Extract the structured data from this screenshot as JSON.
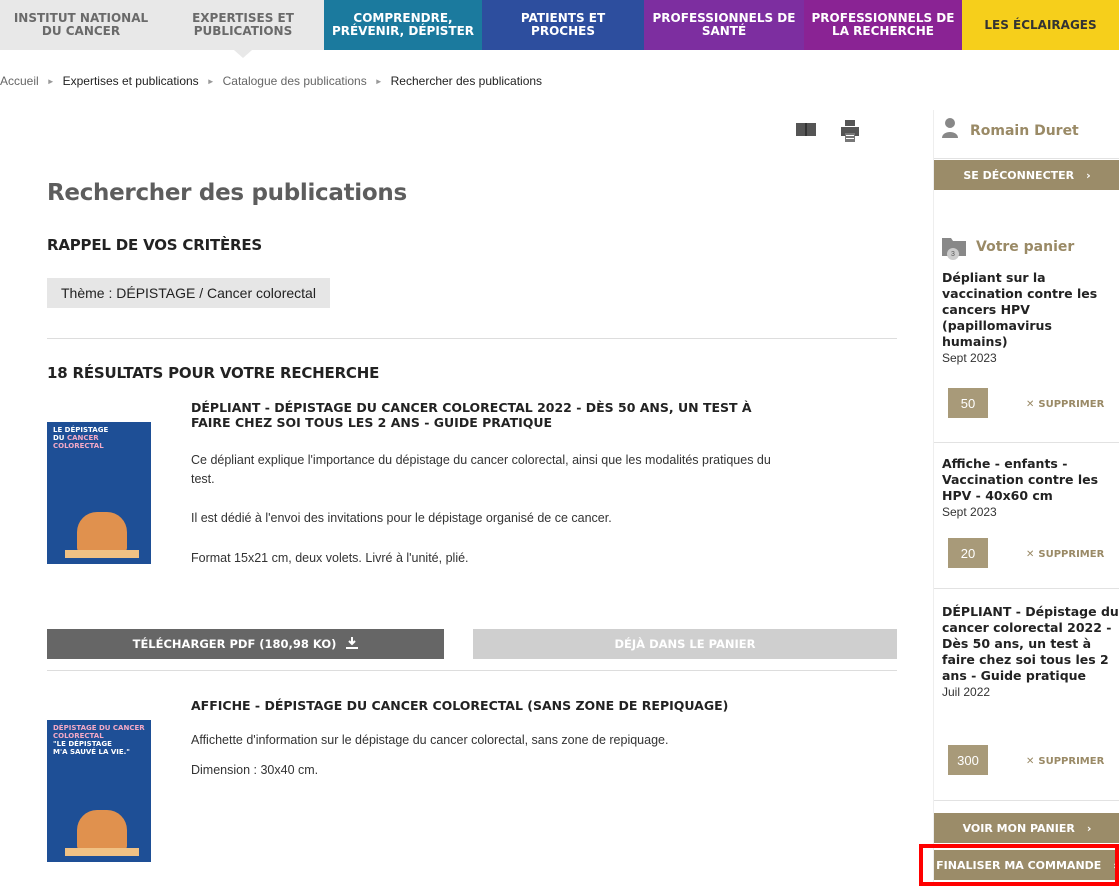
{
  "nav": {
    "items": [
      {
        "label": "Institut National du Cancer"
      },
      {
        "label": "Expertises et publications"
      },
      {
        "label": "Comprendre, prévenir, dépister"
      },
      {
        "label": "Patients et proches"
      },
      {
        "label": "Professionnels de santé"
      },
      {
        "label": "Professionnels de la recherche"
      },
      {
        "label": "Les éclairages"
      }
    ]
  },
  "breadcrumb": [
    "Accueil",
    "Expertises et publications",
    "Catalogue des publications",
    "Rechercher des publications"
  ],
  "page": {
    "title": "Rechercher des publications",
    "criteria_heading": "Rappel de vos critères",
    "criteria_tag": "Thème : DÉPISTAGE / Cancer colorectal",
    "results_heading": "18 résultats pour votre recherche"
  },
  "results": [
    {
      "title": "Dépliant - Dépistage du cancer colorectal 2022 - Dès 50 ans, un test à faire chez soi tous les 2 ans - Guide pratique",
      "desc": [
        "Ce dépliant explique l'importance du dépistage du cancer colorectal, ainsi que les modalités pratiques du test.",
        "Il est dédié à l'envoi des invitations pour le dépistage organisé de ce cancer.",
        "Format 15x21 cm, deux volets. Livré à l'unité, plié."
      ],
      "thumb": {
        "line1": "LE DÉPISTAGE",
        "line2": "DU",
        "line2b": "CANCER",
        "line3": "COLORECTAL"
      },
      "download_label": "TÉLÉCHARGER PDF (180,98 KO)",
      "cart_label": "DÉJÀ DANS LE PANIER"
    },
    {
      "title": "Affiche - Dépistage du cancer colorectal (sans zone de repiquage)",
      "desc": [
        "Affichette d'information sur le dépistage du cancer colorectal, sans zone de repiquage.",
        "Dimension : 30x40 cm."
      ],
      "thumb": {
        "line1": "DÉPISTAGE DU CANCER COLORECTAL",
        "line2": "\"LE DÉPISTAGE",
        "line3": "M'A SAUVÉ LA VIE.\""
      }
    }
  ],
  "sidebar": {
    "user_name": "Romain Duret",
    "logout_label": "SE DÉCONNECTER",
    "cart_title": "Votre panier",
    "cart_count": "3",
    "cart_items": [
      {
        "title": "Dépliant sur la vaccination contre les cancers HPV (papillomavirus humains)",
        "date": "Sept 2023",
        "qty": "50",
        "remove": "SUPPRIMER"
      },
      {
        "title": "Affiche - enfants - Vaccination contre les HPV - 40x60 cm",
        "date": "Sept 2023",
        "qty": "20",
        "remove": "SUPPRIMER"
      },
      {
        "title": "DÉPLIANT - Dépistage du cancer colorectal 2022 - Dès 50 ans, un test à faire chez soi tous les 2 ans - Guide pratique",
        "date": "Juil 2022",
        "qty": "300",
        "remove": "SUPPRIMER"
      }
    ],
    "view_cart_label": "VOIR MON PANIER",
    "checkout_label": "FINALISER MA COMMANDE"
  },
  "colors": {
    "accent": "#9b8c69",
    "highlight_outline": "#ff0000"
  },
  "icons": [
    "book-icon",
    "printer-icon",
    "user-icon",
    "folder-icon",
    "download-icon",
    "close-icon",
    "chevron-right-icon"
  ]
}
